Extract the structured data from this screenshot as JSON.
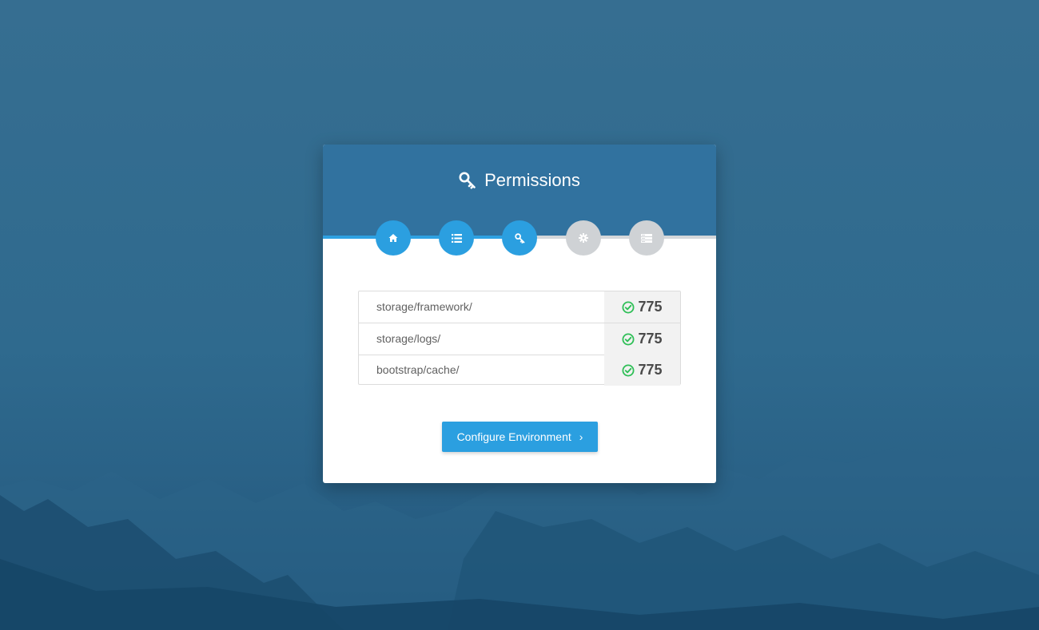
{
  "page": {
    "title": "Permissions",
    "title_icon": "key-icon"
  },
  "steps": [
    {
      "name": "home",
      "icon": "home-icon",
      "state": "complete"
    },
    {
      "name": "requirements",
      "icon": "list-icon",
      "state": "complete"
    },
    {
      "name": "permissions",
      "icon": "key-icon",
      "state": "current"
    },
    {
      "name": "environment",
      "icon": "gear-icon",
      "state": "pending"
    },
    {
      "name": "final",
      "icon": "server-icon",
      "state": "pending"
    }
  ],
  "progress": {
    "fraction": 0.5
  },
  "permissions": {
    "rows": [
      {
        "path": "storage/framework/",
        "value": "775",
        "status_icon": "check-circle-icon",
        "ok": true
      },
      {
        "path": "storage/logs/",
        "value": "775",
        "status_icon": "check-circle-icon",
        "ok": true
      },
      {
        "path": "bootstrap/cache/",
        "value": "775",
        "status_icon": "check-circle-icon",
        "ok": true
      }
    ]
  },
  "actions": {
    "next_label": "Configure Environment",
    "next_icon": "chevron-right-icon"
  },
  "colors": {
    "header": "#31729f",
    "accent": "#2b9fe0",
    "inactive_step": "#cfd2d5",
    "success": "#2fbf57",
    "background": "#2f6a8e"
  }
}
